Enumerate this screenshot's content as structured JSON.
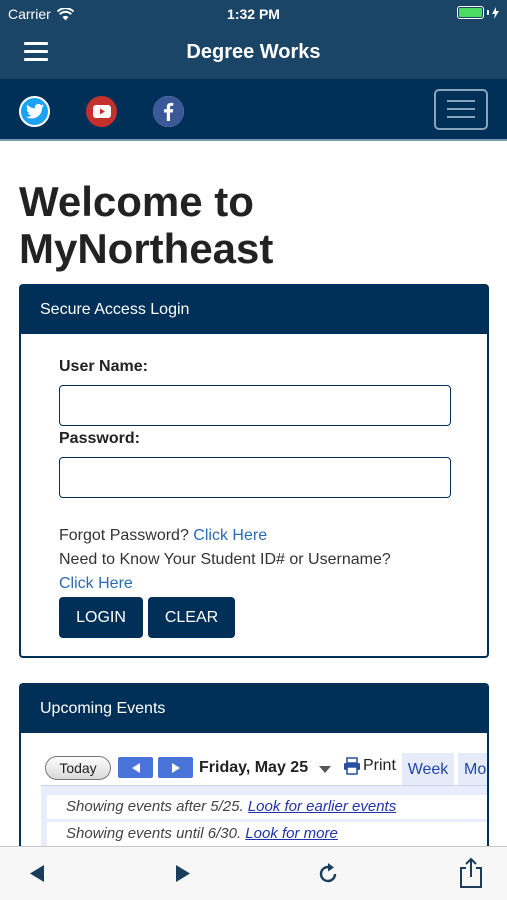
{
  "status": {
    "carrier": "Carrier",
    "time": "1:32 PM"
  },
  "nav": {
    "title": "Degree Works"
  },
  "welcome": {
    "line1": "Welcome to",
    "line2": "MyNortheast"
  },
  "login": {
    "header": "Secure Access Login",
    "username_label": "User Name:",
    "password_label": "Password:",
    "forgot_text": "Forgot Password?",
    "forgot_link": "Click Here",
    "need_text": "Need to Know Your Student ID# or Username?",
    "need_link": "Click Here",
    "login_button": "LOGIN",
    "clear_button": "CLEAR"
  },
  "events": {
    "header": "Upcoming Events",
    "today_button": "Today",
    "date": "Friday, May 25",
    "print": "Print",
    "tab_week": "Week",
    "tab_month": "Month",
    "after_text": "Showing events after 5/25.",
    "after_link": "Look for earlier events",
    "until_text": "Showing events until 6/30.",
    "until_link": "Look for more"
  },
  "colors": {
    "navy": "#003057",
    "nav": "#1a4566",
    "link": "#2a6bb5",
    "battery": "#4cd964"
  }
}
